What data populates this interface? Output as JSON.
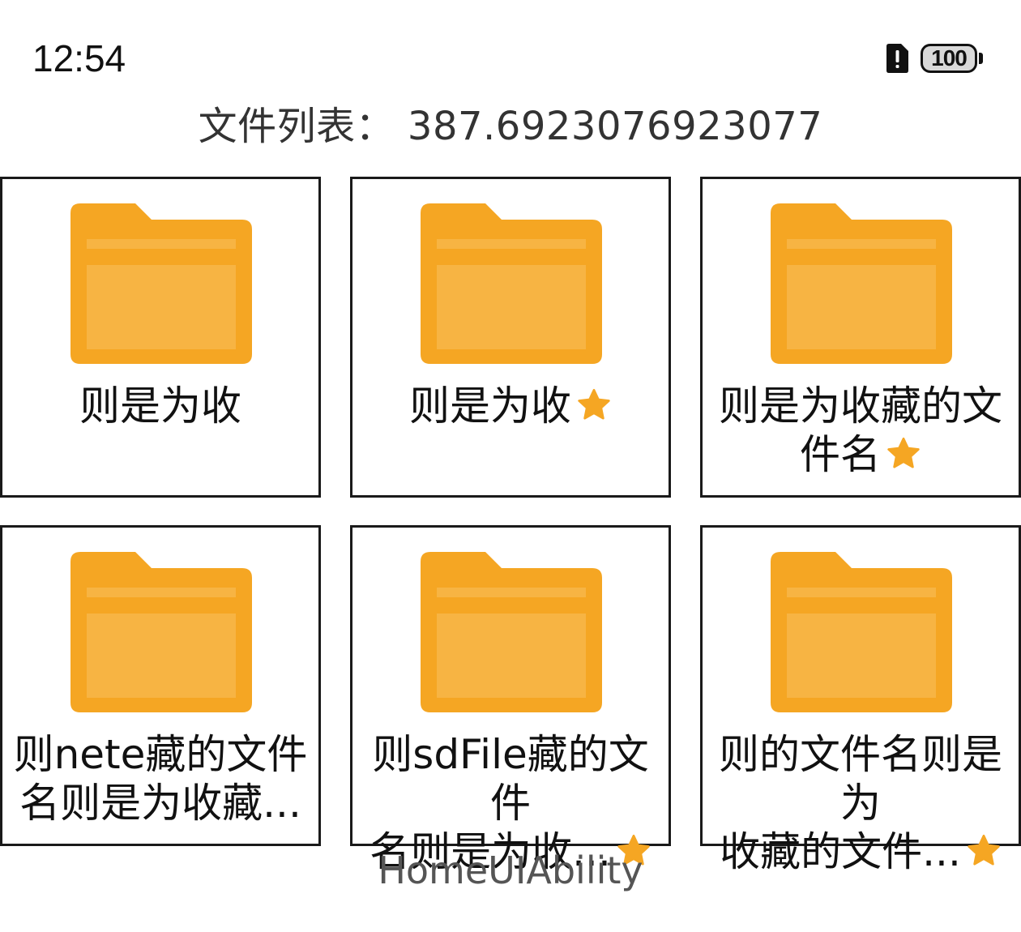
{
  "status_bar": {
    "time": "12:54",
    "battery_level": "100",
    "sim_icon": "sim-alert-icon",
    "battery_icon": "battery-icon"
  },
  "page": {
    "title": "文件列表：  387.6923076923077",
    "footer": "HomeUIAbility"
  },
  "colors": {
    "folder_main": "#F5A623",
    "folder_light": "#F7B443",
    "star": "#F5A623",
    "border": "#1A1A1A"
  },
  "files": [
    {
      "name": "则是为收",
      "starred": false,
      "icon": "folder-icon"
    },
    {
      "name": "则是为收",
      "starred": true,
      "icon": "folder-icon"
    },
    {
      "name": "则是为收藏的文件名",
      "starred": true,
      "icon": "folder-icon"
    },
    {
      "name_line1": "则nete藏的文件",
      "name_line2": "名则是为收藏...",
      "starred": false,
      "icon": "folder-icon"
    },
    {
      "name_line1": "则sdFile藏的文件",
      "name_line2": "名则是为收...",
      "starred": true,
      "icon": "folder-icon"
    },
    {
      "name_line1": "则的文件名则是为",
      "name_line2": "收藏的文件...",
      "starred": true,
      "icon": "folder-icon"
    }
  ]
}
